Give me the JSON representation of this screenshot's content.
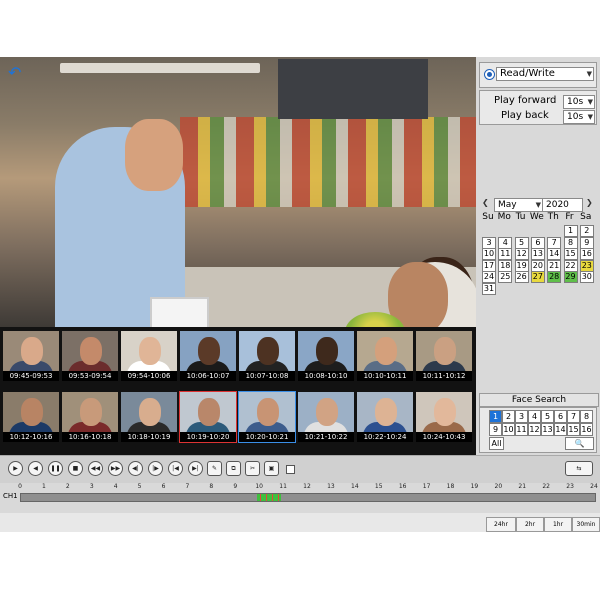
{
  "left_panel": {
    "mode_select": {
      "label": "Read/Write"
    },
    "play_forward": {
      "label": "Play forward",
      "value": "10s"
    },
    "play_back": {
      "label": "Play back",
      "value": "10s"
    }
  },
  "calendar": {
    "month": "May",
    "year": "2020",
    "weekdays": [
      "Su",
      "Mo",
      "Tu",
      "We",
      "Th",
      "Fr",
      "Sa"
    ],
    "days": [
      "1",
      "2",
      "3",
      "4",
      "5",
      "6",
      "7",
      "8",
      "9",
      "10",
      "11",
      "12",
      "13",
      "14",
      "15",
      "16",
      "17",
      "18",
      "19",
      "20",
      "21",
      "22",
      "23",
      "24",
      "25",
      "26",
      "27",
      "28",
      "29",
      "30",
      "31"
    ],
    "highlight_green": [
      "28",
      "29"
    ],
    "highlight_yellow": [
      "23",
      "27"
    ]
  },
  "face_search": {
    "title": "Face Search",
    "pages": [
      "1",
      "2",
      "3",
      "4",
      "5",
      "6",
      "7",
      "8",
      "9",
      "10",
      "11",
      "12",
      "13",
      "14",
      "15",
      "16"
    ],
    "all_label": "All",
    "search_icon": "search-icon"
  },
  "thumbnails": [
    "09:45-09:53",
    "09:53-09:54",
    "09:54-10:06",
    "10:06-10:07",
    "10:07-10:08",
    "10:08-10:10",
    "10:10-10:11",
    "10:11-10:12",
    "10:12-10:16",
    "10:16-10:18",
    "10:18-10:19",
    "10:19-10:20",
    "10:20-10:21",
    "10:21-10:22",
    "10:22-10:24",
    "10:24-10:43"
  ],
  "timeline": {
    "channel": "CH1",
    "hours": [
      "0",
      "1",
      "2",
      "3",
      "4",
      "5",
      "6",
      "7",
      "8",
      "9",
      "10",
      "11",
      "12",
      "13",
      "14",
      "15",
      "16",
      "17",
      "18",
      "19",
      "20",
      "21",
      "22",
      "23",
      "24"
    ]
  },
  "zoom_levels": [
    "24hr",
    "2hr",
    "1hr",
    "30min"
  ],
  "colors": {
    "accent": "#1e73d8",
    "record_green": "#3fbf3f"
  }
}
